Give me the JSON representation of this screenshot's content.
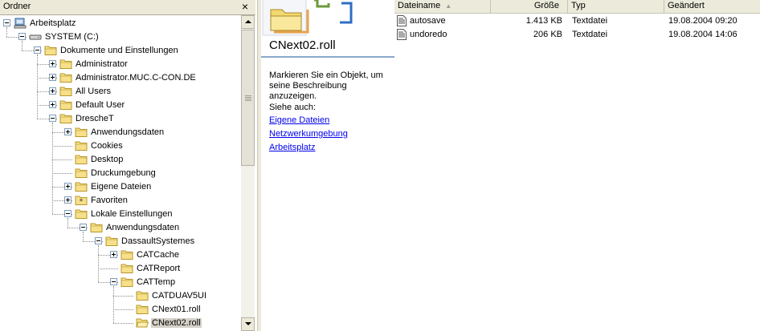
{
  "folder_pane": {
    "title": "Ordner",
    "close_glyph": "×",
    "tree": [
      {
        "label": "Arbeitsplatz",
        "level": 0,
        "expander": "minus",
        "icon": "computer-icon"
      },
      {
        "label": "SYSTEM (C:)",
        "level": 1,
        "expander": "minus",
        "icon": "drive-icon"
      },
      {
        "label": "Dokumente und Einstellungen",
        "level": 2,
        "expander": "minus",
        "icon": "folder-icon"
      },
      {
        "label": "Administrator",
        "level": 3,
        "expander": "plus",
        "icon": "folder-icon"
      },
      {
        "label": "Administrator.MUC.C-CON.DE",
        "level": 3,
        "expander": "plus",
        "icon": "folder-icon"
      },
      {
        "label": "All Users",
        "level": 3,
        "expander": "plus",
        "icon": "folder-icon"
      },
      {
        "label": "Default User",
        "level": 3,
        "expander": "plus",
        "icon": "folder-icon"
      },
      {
        "label": "DrescheT",
        "level": 3,
        "expander": "minus",
        "icon": "folder-icon"
      },
      {
        "label": "Anwendungsdaten",
        "level": 4,
        "expander": "plus",
        "icon": "folder-icon"
      },
      {
        "label": "Cookies",
        "level": 4,
        "expander": "none",
        "icon": "folder-icon"
      },
      {
        "label": "Desktop",
        "level": 4,
        "expander": "none",
        "icon": "folder-icon"
      },
      {
        "label": "Druckumgebung",
        "level": 4,
        "expander": "none",
        "icon": "folder-icon"
      },
      {
        "label": "Eigene Dateien",
        "level": 4,
        "expander": "plus",
        "icon": "folder-icon"
      },
      {
        "label": "Favoriten",
        "level": 4,
        "expander": "plus",
        "icon": "favorites-folder-icon"
      },
      {
        "label": "Lokale Einstellungen",
        "level": 4,
        "expander": "minus",
        "icon": "folder-icon"
      },
      {
        "label": "Anwendungsdaten",
        "level": 5,
        "expander": "minus",
        "icon": "folder-icon"
      },
      {
        "label": "DassaultSystemes",
        "level": 6,
        "expander": "minus",
        "icon": "folder-icon"
      },
      {
        "label": "CATCache",
        "level": 7,
        "expander": "plus",
        "icon": "folder-icon"
      },
      {
        "label": "CATReport",
        "level": 7,
        "expander": "none",
        "icon": "folder-icon"
      },
      {
        "label": "CATTemp",
        "level": 7,
        "expander": "minus",
        "icon": "folder-icon"
      },
      {
        "label": "CATDUAV5UI",
        "level": 8,
        "expander": "none",
        "icon": "folder-icon"
      },
      {
        "label": "CNext01.roll",
        "level": 8,
        "expander": "none",
        "icon": "folder-icon"
      },
      {
        "label": "CNext02.roll",
        "level": 8,
        "expander": "none",
        "icon": "folder-open-icon",
        "selected": true
      }
    ]
  },
  "info_pane": {
    "icon": "folder-large-icon",
    "heading": "CNext02.roll",
    "description": "Markieren Sie ein Objekt, um seine Beschreibung anzuzeigen.",
    "see_also": "Siehe auch:",
    "links": [
      "Eigene Dateien",
      "Netzwerkumgebung",
      "Arbeitsplatz"
    ]
  },
  "file_list": {
    "columns": [
      {
        "label": "Dateiname",
        "sorted": true
      },
      {
        "label": "Größe"
      },
      {
        "label": "Typ"
      },
      {
        "label": "Geändert"
      }
    ],
    "sort_glyph": "▲",
    "files": [
      {
        "name": "autosave",
        "size": "1.413 KB",
        "type": "Textdatei",
        "modified": "19.08.2004 09:20",
        "icon": "text-file-icon"
      },
      {
        "name": "undoredo",
        "size": "206 KB",
        "type": "Textdatei",
        "modified": "19.08.2004 14:06",
        "icon": "text-file-icon"
      }
    ]
  },
  "colors": {
    "link": "#0000ee",
    "folder_fill": "#f7e08b",
    "folder_stroke": "#b9972a",
    "selection": "#d4d0c8",
    "header_bg": "#ece9d8"
  }
}
